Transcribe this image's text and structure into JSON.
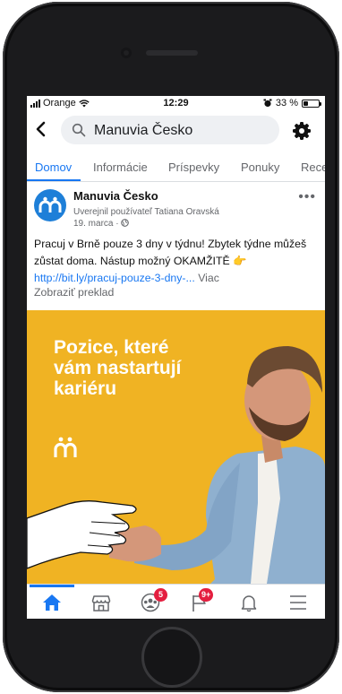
{
  "status": {
    "carrier": "Orange",
    "time": "12:29",
    "battery": "33 %",
    "battery_level": 0.33
  },
  "search": {
    "query": "Manuvia Česko"
  },
  "tabs": [
    {
      "label": "Domov",
      "active": true
    },
    {
      "label": "Informácie"
    },
    {
      "label": "Príspevky"
    },
    {
      "label": "Ponuky"
    },
    {
      "label": "Rece"
    }
  ],
  "post": {
    "page_name": "Manuvia Česko",
    "posted_by": "Uverejnil používateľ Tatiana Oravská",
    "date": "19. marca ·",
    "text": "Pracuj v Brně pouze 3 dny v týdnu! Zbytek týdne můžeš zůstat doma. Nástup možný OKAMŽITĚ 👉",
    "link": "http://bit.ly/pracuj-pouze-3-dny-...",
    "more_label": "Viac",
    "translate_label": "Zobraziť preklad",
    "image_headline": "Pozice, které vám nastartují kariéru",
    "image_bg_color": "#f0b323"
  },
  "bottom_nav": [
    {
      "icon": "home-icon",
      "active": true
    },
    {
      "icon": "marketplace-icon"
    },
    {
      "icon": "groups-icon",
      "badge": "5"
    },
    {
      "icon": "pages-flag-icon",
      "badge": "9+"
    },
    {
      "icon": "notifications-bell-icon"
    },
    {
      "icon": "menu-icon"
    }
  ],
  "colors": {
    "accent": "#1877f2",
    "badge": "#e41e3f"
  }
}
